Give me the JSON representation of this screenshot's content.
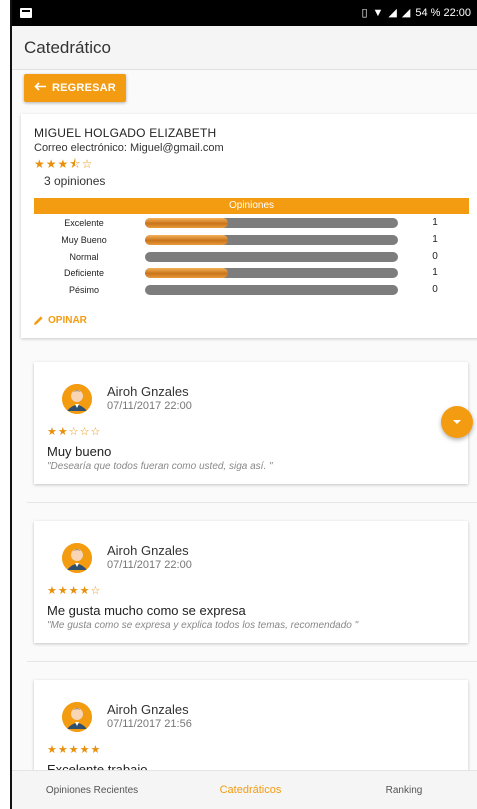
{
  "status_bar": {
    "battery_time": "54 % 22:00"
  },
  "app_bar": {
    "title": "Catedrático"
  },
  "back_button": {
    "label": "REGRESAR"
  },
  "professor": {
    "name": "MIGUEL HOLGADO ELIZABETH",
    "email": "Correo electrónico: Miguel@gmail.com",
    "stars": "★★★⯪☆",
    "rating_value": 3.5,
    "opinions_count": "3 opiniones",
    "opinions_header": "Opiniones",
    "breakdown": [
      {
        "label": "Excelente",
        "count": "1",
        "fill": 0.33
      },
      {
        "label": "Muy Bueno",
        "count": "1",
        "fill": 0.33
      },
      {
        "label": "Normal",
        "count": "0",
        "fill": 0
      },
      {
        "label": "Deficiente",
        "count": "1",
        "fill": 0.33
      },
      {
        "label": "Pésimo",
        "count": "0",
        "fill": 0
      }
    ],
    "opinar_label": "OPINAR"
  },
  "reviews": [
    {
      "user": "Airoh Gnzales",
      "date": "07/11/2017 22:00",
      "stars": "★★☆☆☆",
      "rating": 2,
      "title": "Muy bueno",
      "comment": "\"Desearía que todos fueran como usted, siga así. \""
    },
    {
      "user": "Airoh Gnzales",
      "date": "07/11/2017 22:00",
      "stars": "★★★★☆",
      "rating": 4,
      "title": "Me gusta mucho como se expresa",
      "comment": "\"Me gusta como se expresa y explica todos los temas, recomendado \""
    },
    {
      "user": "Airoh Gnzales",
      "date": "07/11/2017 21:56",
      "stars": "★★★★★",
      "rating": 5,
      "title": "Excelente trabajo",
      "comment": ""
    }
  ],
  "bottom_nav": {
    "items": [
      {
        "label": "Opiniones Recientes"
      },
      {
        "label": "Catedráticos"
      },
      {
        "label": "Ranking"
      }
    ],
    "active_index": 1
  },
  "colors": {
    "accent": "#f39c12",
    "star": "#e8900c"
  },
  "icons": {
    "back": "arrow-left-icon",
    "opinar": "pencil-icon",
    "fab": "chevron-down-icon"
  }
}
